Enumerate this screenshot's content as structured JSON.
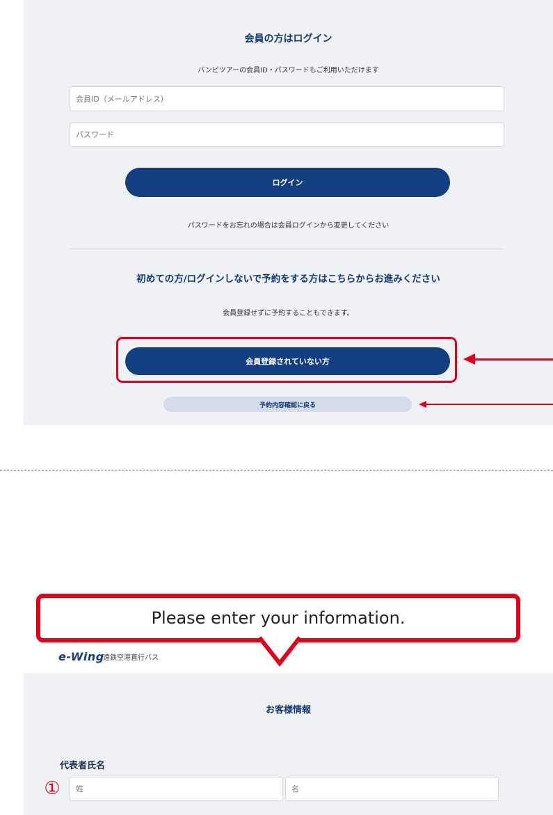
{
  "login": {
    "title": "会員の方はログイン",
    "subtitle": "バンビツアーの会員ID・パスワードもご利用いただけます",
    "id_placeholder": "会員ID（メールアドレス）",
    "password_placeholder": "パスワード",
    "login_button": "ログイン",
    "forgot_text": "パスワードをお忘れの場合は会員ログインから変更してください"
  },
  "guest": {
    "title": "初めての方/ログインしないで予約をする方はこちらからお進みください",
    "subtitle": "会員登録せずに予約することもできます。",
    "non_member_button": "会員登録されていない方",
    "back_button": "予約内容確認に戻る"
  },
  "callout": {
    "text": "Please enter your information."
  },
  "header": {
    "logo": "e-Wing",
    "subtitle": "遠鉄空港直行バス"
  },
  "customer": {
    "title": "お客様情報",
    "name_label": "代表者氏名",
    "step_marker": "①",
    "last_name_placeholder": "姓",
    "first_name_placeholder": "名"
  },
  "colors": {
    "accent": "#e0001b",
    "primary": "#123f82",
    "panel_bg": "#eff1f4"
  }
}
